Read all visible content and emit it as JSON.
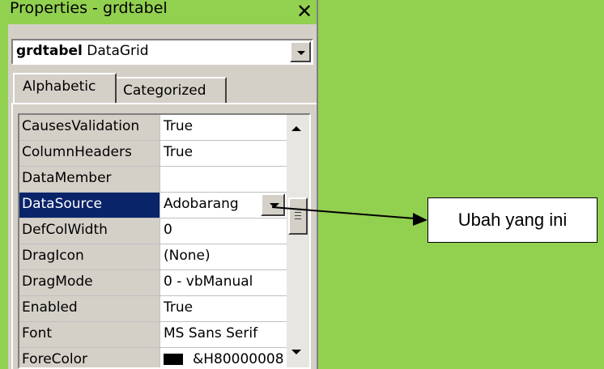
{
  "window": {
    "title": "Properties - grdtabel",
    "close_glyph": "✕"
  },
  "object_selector": {
    "name": "grdtabel",
    "type": "DataGrid"
  },
  "tabs": [
    {
      "label": "Alphabetic",
      "active": true
    },
    {
      "label": "Categorized",
      "active": false
    }
  ],
  "properties": [
    {
      "name": "CausesValidation",
      "value": "True"
    },
    {
      "name": "ColumnHeaders",
      "value": "True"
    },
    {
      "name": "DataMember",
      "value": ""
    },
    {
      "name": "DataSource",
      "value": "Adobarang",
      "selected": true
    },
    {
      "name": "DefColWidth",
      "value": "0"
    },
    {
      "name": "DragIcon",
      "value": "(None)"
    },
    {
      "name": "DragMode",
      "value": "0 - vbManual"
    },
    {
      "name": "Enabled",
      "value": "True"
    },
    {
      "name": "Font",
      "value": "MS Sans Serif"
    },
    {
      "name": "ForeColor",
      "value": "&H80000008"
    }
  ],
  "annotation": {
    "label": "Ubah yang ini"
  },
  "colors": {
    "background": "#92d050",
    "selected_row": "#0a246a"
  }
}
